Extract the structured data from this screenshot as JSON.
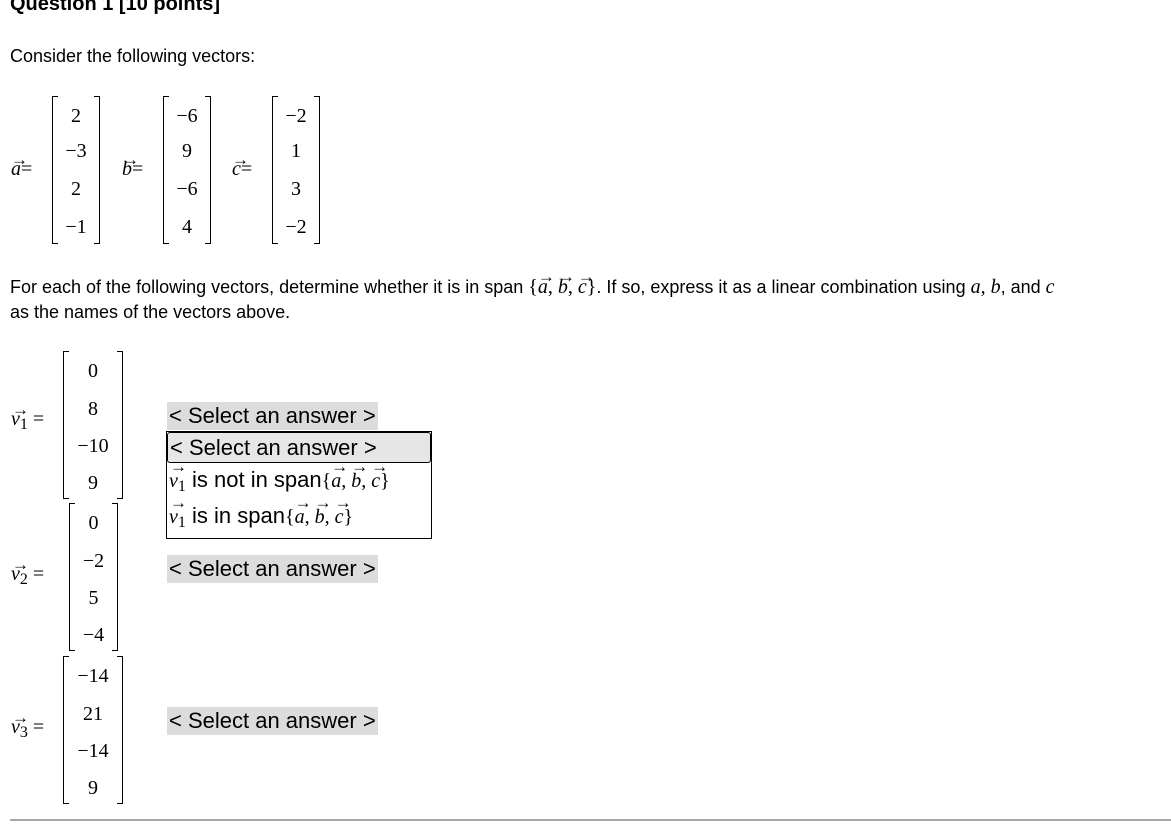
{
  "question": {
    "title": "Question 1 [10 points]",
    "intro": "Consider the following vectors:",
    "instruction_part1": "For each of the following vectors, determine whether it is in span",
    "instruction_part2": ". If so, express it as a linear combination using",
    "instruction_part3": ", and",
    "instruction_line2": "as the names of the vectors above.",
    "var_a": "a",
    "var_b": "b",
    "var_c": "c"
  },
  "vectors": {
    "a": {
      "name": "a",
      "values": [
        "2",
        "−3",
        "2",
        "−1"
      ]
    },
    "b": {
      "name": "b",
      "values": [
        "−6",
        "9",
        "−6",
        "4"
      ]
    },
    "c": {
      "name": "c",
      "values": [
        "−2",
        "1",
        "3",
        "−2"
      ]
    }
  },
  "targets": [
    {
      "name": "v",
      "sub": "1",
      "values": [
        "0",
        "8",
        "−10",
        "9"
      ],
      "answer": "< Select an answer >"
    },
    {
      "name": "v",
      "sub": "2",
      "values": [
        "0",
        "−2",
        "5",
        "−4"
      ],
      "answer": "< Select an answer >"
    },
    {
      "name": "v",
      "sub": "3",
      "values": [
        "−14",
        "21",
        "−14",
        "9"
      ],
      "answer": "< Select an answer >"
    }
  ],
  "dropdown": {
    "options": [
      {
        "label": "< Select an answer >"
      },
      {
        "prefix_sub": "1",
        "label": " is not in span"
      },
      {
        "prefix_sub": "1",
        "label": " is in span"
      }
    ]
  },
  "symbols": {
    "equals": "=",
    "arrow": "→",
    "lbrace": "{",
    "rbrace": "}",
    "comma": ", "
  },
  "colors": {
    "select_bg": "#dcdcdc",
    "divider": "#a8a8a8"
  }
}
